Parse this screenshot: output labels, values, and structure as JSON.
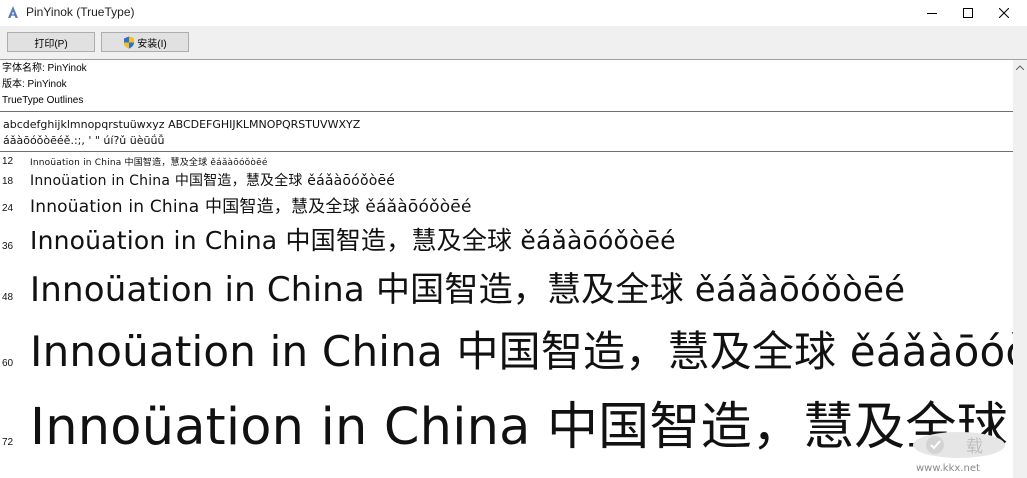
{
  "window": {
    "title": "PinYinok (TrueType)",
    "controls": [
      "minimize-icon",
      "maximize-icon",
      "close-icon"
    ]
  },
  "toolbar": {
    "print_label": "打印(P)",
    "install_label": "安装(I)",
    "install_icon": "shield-icon"
  },
  "font_info": {
    "name_line": "字体名称: PinYinok",
    "version_line": "版本: PinYinok",
    "type_line": "TrueType Outlines"
  },
  "charset": {
    "line1": "abcdefghijklmnopqrstuüwxyz ABCDEFGHIJKLMNOPQRSTUVWXYZ",
    "line2": "áǎàōóǒòēéě.:;, ' \" úí?ǔ üèūǘǚ"
  },
  "samples": [
    {
      "size": "12",
      "text": "Innoüation in China 中国智造，慧及全球 ěáǎàōóǒòēé"
    },
    {
      "size": "18",
      "text": "Innoüation in China 中国智造，慧及全球 ěáǎàōóǒòēé"
    },
    {
      "size": "24",
      "text": "Innoüation in China 中国智造，慧及全球 ěáǎàōóǒòēé"
    },
    {
      "size": "36",
      "text": "Innoüation in China 中国智造，慧及全球 ěáǎàōóǒòēé"
    },
    {
      "size": "48",
      "text": "Innoüation in China 中国智造，慧及全球 ěáǎàōóǒòēé"
    },
    {
      "size": "60",
      "text": "Innoüation in China 中国智造，慧及全球 ěáǎàōóǒòēé"
    },
    {
      "size": "72",
      "text": "Innoüation in China 中国智造，慧及全球 ěáǎàōóǒòēé"
    }
  ],
  "watermark": {
    "badge_text": "载",
    "url": "www.kkx.net"
  }
}
